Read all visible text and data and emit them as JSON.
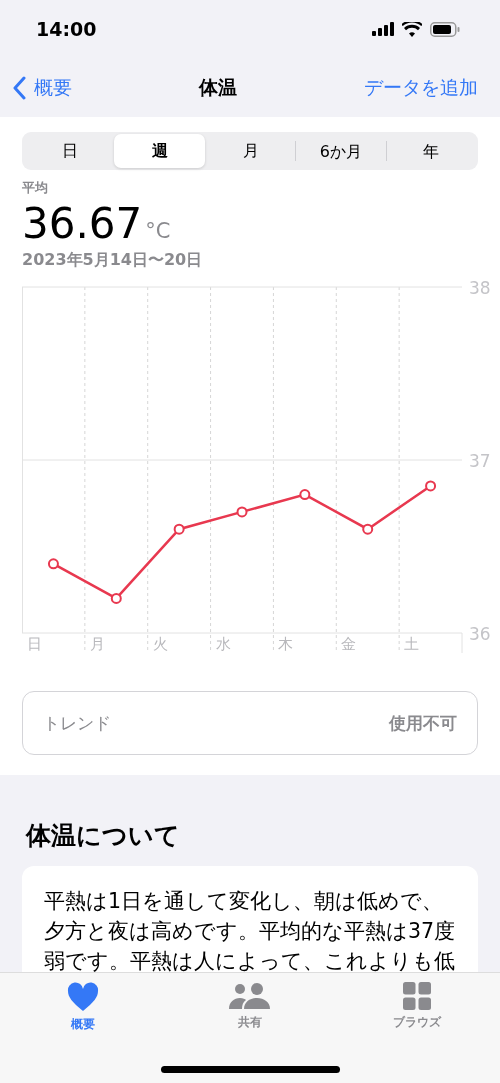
{
  "status_bar": {
    "time": "14:00"
  },
  "nav": {
    "back": "概要",
    "title": "体温",
    "action": "データを追加"
  },
  "segments": [
    {
      "label": "日",
      "selected": false
    },
    {
      "label": "週",
      "selected": true
    },
    {
      "label": "月",
      "selected": false
    },
    {
      "label": "6か月",
      "selected": false
    },
    {
      "label": "年",
      "selected": false
    }
  ],
  "summary": {
    "label": "平均",
    "value": "36.67",
    "unit": "°C",
    "range": "2023年5月14日〜20日"
  },
  "chart_data": {
    "type": "line",
    "categories": [
      "日",
      "月",
      "火",
      "水",
      "木",
      "金",
      "土"
    ],
    "ylim": [
      36,
      38
    ],
    "yticks": [
      36,
      37,
      38
    ],
    "series": [
      {
        "color": "#e8384f",
        "marker": "circle",
        "values": [
          36.4,
          36.2,
          36.6,
          36.7,
          36.8,
          36.6,
          36.85
        ]
      }
    ]
  },
  "trend": {
    "label": "トレンド",
    "value": "使用不可"
  },
  "about": {
    "heading": "体温について",
    "text": "平熱は1日を通して変化し、朝は低めで、夕方と夜は高めです。平均的な平熱は37度弱です。平熱は人によって、これよりも低"
  },
  "tab_bar": [
    {
      "label": "概要",
      "kind": "heart",
      "selected": true
    },
    {
      "label": "共有",
      "kind": "people",
      "selected": false
    },
    {
      "label": "ブラウズ",
      "kind": "grid",
      "selected": false
    }
  ]
}
